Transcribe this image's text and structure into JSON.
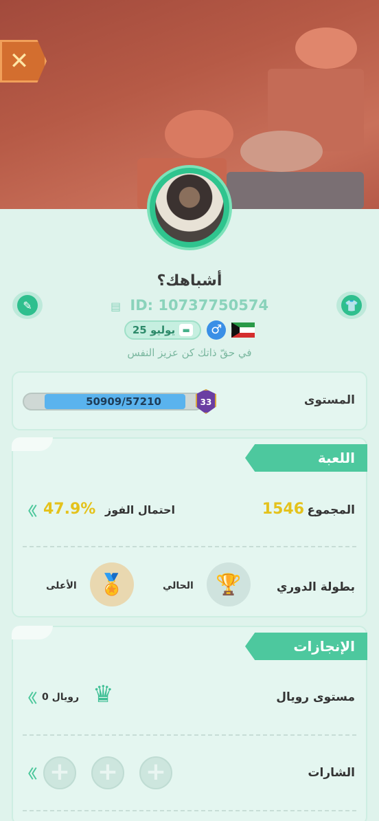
{
  "profile": {
    "name": "أشباهك؟",
    "id_text": "ID: 10737750574",
    "birthday": "25 يوليو",
    "gender_symbol": "♂",
    "bio": "في حقّ ذاتك كن عزيز النفس"
  },
  "header": {
    "close_symbol": "✕"
  },
  "level": {
    "label": "المستوى",
    "progress_text": "50909/57210",
    "current": 50909,
    "target": 57210,
    "level_number": "33"
  },
  "game": {
    "title": "اللعبة",
    "total_label": "المجموع",
    "total_value": "1546",
    "win_rate_label": "احتمال الفوز",
    "win_rate_value": "47.9%",
    "league_label": "بطولة الدوري",
    "current_label": "الحالي",
    "highest_label": "الأعلى"
  },
  "achievements": {
    "title": "الإنجازات",
    "royal_label": "مستوى رويال",
    "royal_value": "رويال 0",
    "badges_label": "الشارات",
    "badge_slots": [
      "+",
      "+",
      "+"
    ]
  },
  "icons": {
    "edit": "edit-icon",
    "shirt": "shirt-icon",
    "document": "document-icon",
    "cake": "cake-icon",
    "trophy": "trophy-icon",
    "medal": "medal-icon",
    "crown": "crown-icon"
  },
  "colors": {
    "accent_green": "#4dc89e",
    "gold": "#e4c21c",
    "progress_blue": "#5ab3ee",
    "hero_bg": "#b65a46"
  }
}
